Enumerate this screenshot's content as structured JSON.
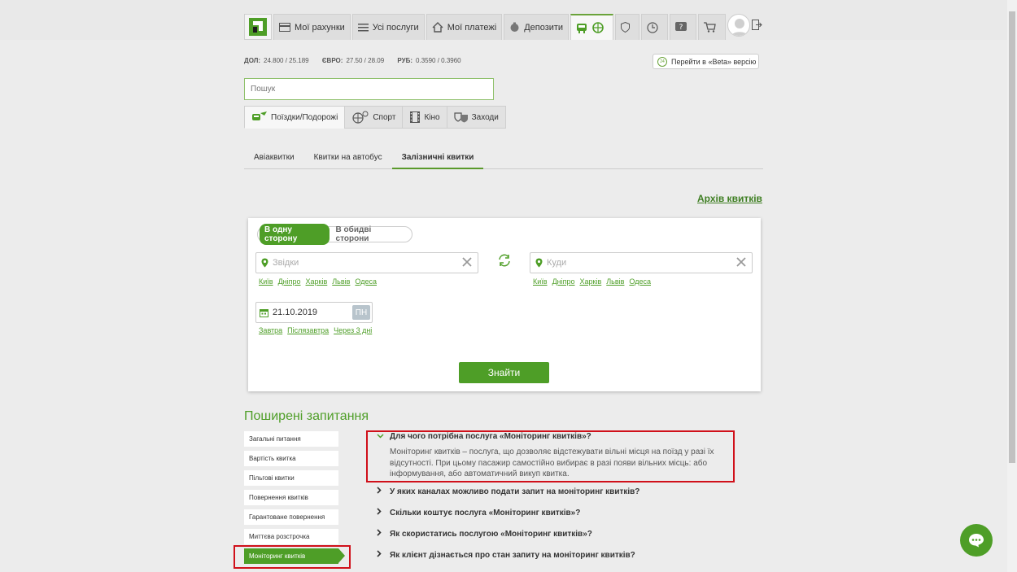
{
  "nav": {
    "items": [
      {
        "label": "Мої рахунки",
        "icon": "card-icon"
      },
      {
        "label": "Усі послуги",
        "icon": "list-icon"
      },
      {
        "label": "Мої платежі",
        "icon": "house-icon"
      },
      {
        "label": "Депозити",
        "icon": "piggy-icon"
      }
    ]
  },
  "rates": {
    "usd_label": "ДОЛ:",
    "usd": "24.800 / 25.189",
    "eur_label": "ЄВРО:",
    "eur": "27.50 / 28.09",
    "rub_label": "РУБ:",
    "rub": "0.3590 / 0.3960"
  },
  "beta": {
    "badge": "24",
    "label": "Перейти в «Beta» версію"
  },
  "search": {
    "placeholder": "Пошук"
  },
  "categories": [
    {
      "label": "Поїздки/Подорожі"
    },
    {
      "label": "Спорт"
    },
    {
      "label": "Кіно"
    },
    {
      "label": "Заходи"
    }
  ],
  "subtabs": [
    {
      "label": "Авіаквитки"
    },
    {
      "label": "Квитки на автобус"
    },
    {
      "label": "Залізничні квитки"
    }
  ],
  "archive_link": "Архів квитків",
  "booking": {
    "one_way": "В одну сторону",
    "round_trip": "В обидві сторони",
    "from_placeholder": "Звідки",
    "to_placeholder": "Куди",
    "cities": [
      "Київ",
      "Дніпро",
      "Харків",
      "Львів",
      "Одеса"
    ],
    "date": "21.10.2019",
    "day_of_week": "ПН",
    "date_quick": [
      "Завтра",
      "Післязавтра",
      "Через 3 дні"
    ],
    "find_button": "Знайти"
  },
  "faq": {
    "title": "Поширені запитання",
    "categories": [
      "Загальні питання",
      "Вартість квитка",
      "Пільгові квитки",
      "Повернення квитків",
      "Гарантоване повернення",
      "Миттєва розстрочка",
      "Моніторинг квитків"
    ],
    "questions": [
      "Для чого потрібна послуга «Моніторинг квитків»?",
      "У яких каналах можливо подати запит на моніторинг квитків?",
      "Скільки коштує послуга «Моніторинг квитків»?",
      "Як скористатись послугою «Моніторинг квитків»?",
      "Як клієнт дізнається про стан запиту на моніторинг квитків?"
    ],
    "answer": "Моніторинг квитків – послуга, що дозволяє відстежувати вільні місця на поїзд у разі їх відсутності. При цьому пасажир самостійно вибирає в разі появи вільних місць: або інформування, або автоматичний викуп квитка."
  },
  "colors": {
    "accent": "#4e9e27",
    "highlight": "#d0101a"
  }
}
